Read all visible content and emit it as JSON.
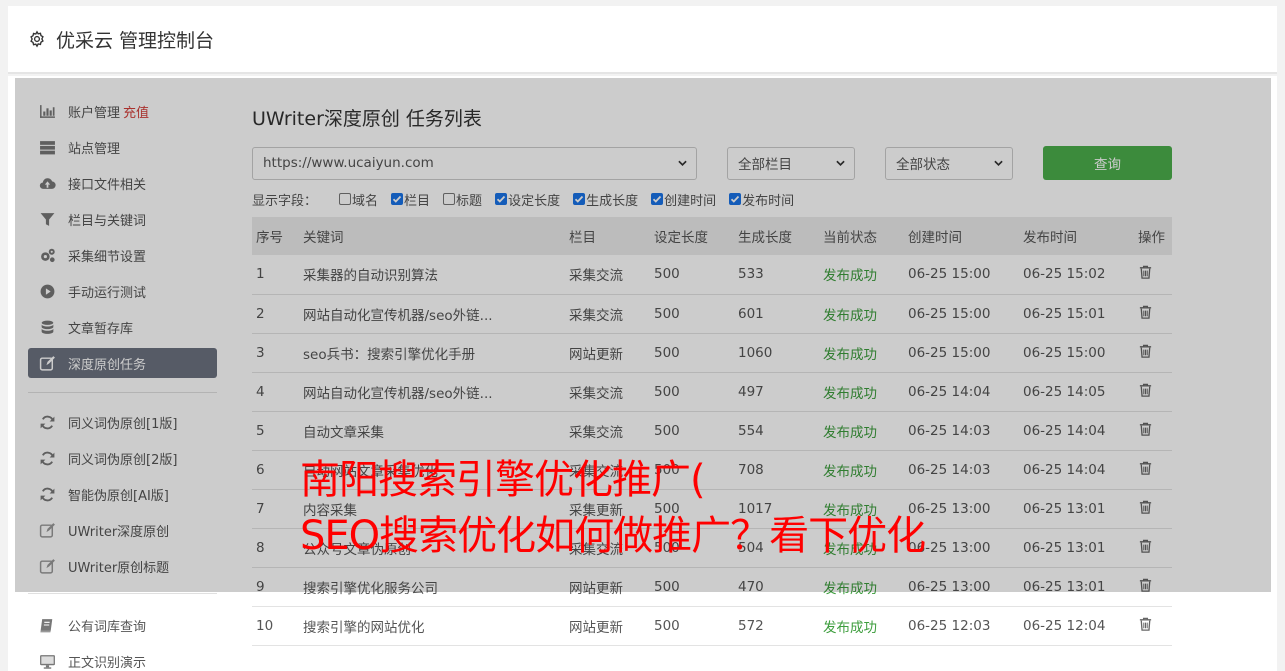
{
  "header": {
    "title": "优采云 管理控制台"
  },
  "sidebar": {
    "group1": [
      {
        "label": "账户管理",
        "badge": "充值",
        "icon": "bar-chart-icon"
      },
      {
        "label": "站点管理",
        "icon": "server-icon"
      },
      {
        "label": "接口文件相关",
        "icon": "cloud-upload-icon"
      },
      {
        "label": "栏目与关键词",
        "icon": "filter-icon"
      },
      {
        "label": "采集细节设置",
        "icon": "gears-icon"
      },
      {
        "label": "手动运行测试",
        "icon": "play-circle-icon"
      },
      {
        "label": "文章暂存库",
        "icon": "database-icon"
      },
      {
        "label": "深度原创任务",
        "icon": "edit-icon"
      }
    ],
    "group2": [
      {
        "label": "同义词伪原创[1版]",
        "icon": "refresh-icon"
      },
      {
        "label": "同义词伪原创[2版]",
        "icon": "refresh-icon"
      },
      {
        "label": "智能伪原创[AI版]",
        "icon": "refresh-icon"
      },
      {
        "label": "UWriter深度原创",
        "icon": "edit-icon"
      },
      {
        "label": "UWriter原创标题",
        "icon": "edit-icon"
      }
    ],
    "group3": [
      {
        "label": "公有词库查询",
        "icon": "book-icon"
      },
      {
        "label": "正文识别演示",
        "icon": "monitor-icon"
      }
    ]
  },
  "main": {
    "title": "UWriter深度原创 任务列表",
    "site_select": "https://www.ucaiyun.com",
    "column_select": "全部栏目",
    "status_select": "全部状态",
    "query_button": "查询",
    "fields_label": "显示字段：",
    "fields": [
      {
        "label": "域名",
        "checked": false
      },
      {
        "label": "栏目",
        "checked": true
      },
      {
        "label": "标题",
        "checked": false
      },
      {
        "label": "设定长度",
        "checked": true
      },
      {
        "label": "生成长度",
        "checked": true
      },
      {
        "label": "创建时间",
        "checked": true
      },
      {
        "label": "发布时间",
        "checked": true
      }
    ],
    "table": {
      "headers": [
        "序号",
        "关键词",
        "栏目",
        "设定长度",
        "生成长度",
        "当前状态",
        "创建时间",
        "发布时间",
        "操作"
      ],
      "rows": [
        [
          "1",
          "采集器的自动识别算法",
          "采集交流",
          "500",
          "533",
          "发布成功",
          "06-25 15:00",
          "06-25 15:02"
        ],
        [
          "2",
          "网站自动化宣传机器/seo外链...",
          "采集交流",
          "500",
          "601",
          "发布成功",
          "06-25 15:00",
          "06-25 15:01"
        ],
        [
          "3",
          "seo兵书：搜索引擎优化手册",
          "网站更新",
          "500",
          "1060",
          "发布成功",
          "06-25 15:00",
          "06-25 15:00"
        ],
        [
          "4",
          "网站自动化宣传机器/seo外链...",
          "采集交流",
          "500",
          "497",
          "发布成功",
          "06-25 14:04",
          "06-25 14:05"
        ],
        [
          "5",
          "自动文章采集",
          "采集交流",
          "500",
          "554",
          "发布成功",
          "06-25 14:03",
          "06-25 14:04"
        ],
        [
          "6",
          "自动网站文章采集优化",
          "采集交流",
          "500",
          "708",
          "发布成功",
          "06-25 14:03",
          "06-25 14:04"
        ],
        [
          "7",
          "内容采集",
          "采集更新",
          "500",
          "1017",
          "发布成功",
          "06-25 13:00",
          "06-25 13:01"
        ],
        [
          "8",
          "公众号文章伪原创",
          "采集交流",
          "500",
          "504",
          "发布成功",
          "06-25 13:00",
          "06-25 13:01"
        ],
        [
          "9",
          "搜索引擎优化服务公司",
          "网站更新",
          "500",
          "470",
          "发布成功",
          "06-25 13:00",
          "06-25 13:01"
        ],
        [
          "10",
          "搜索引擎的网站优化",
          "网站更新",
          "500",
          "572",
          "发布成功",
          "06-25 12:03",
          "06-25 12:04"
        ]
      ]
    }
  },
  "watermark": {
    "line1": "南阳搜索引擎优化推广(",
    "line2": "SEO搜索优化如何做推广？看下优化"
  },
  "colors": {
    "active_sidebar": "#6c7280",
    "query_button": "#4cae4c",
    "status_success": "#3c9d3c",
    "recharge": "#d43f3a",
    "watermark": "#ff0000"
  }
}
